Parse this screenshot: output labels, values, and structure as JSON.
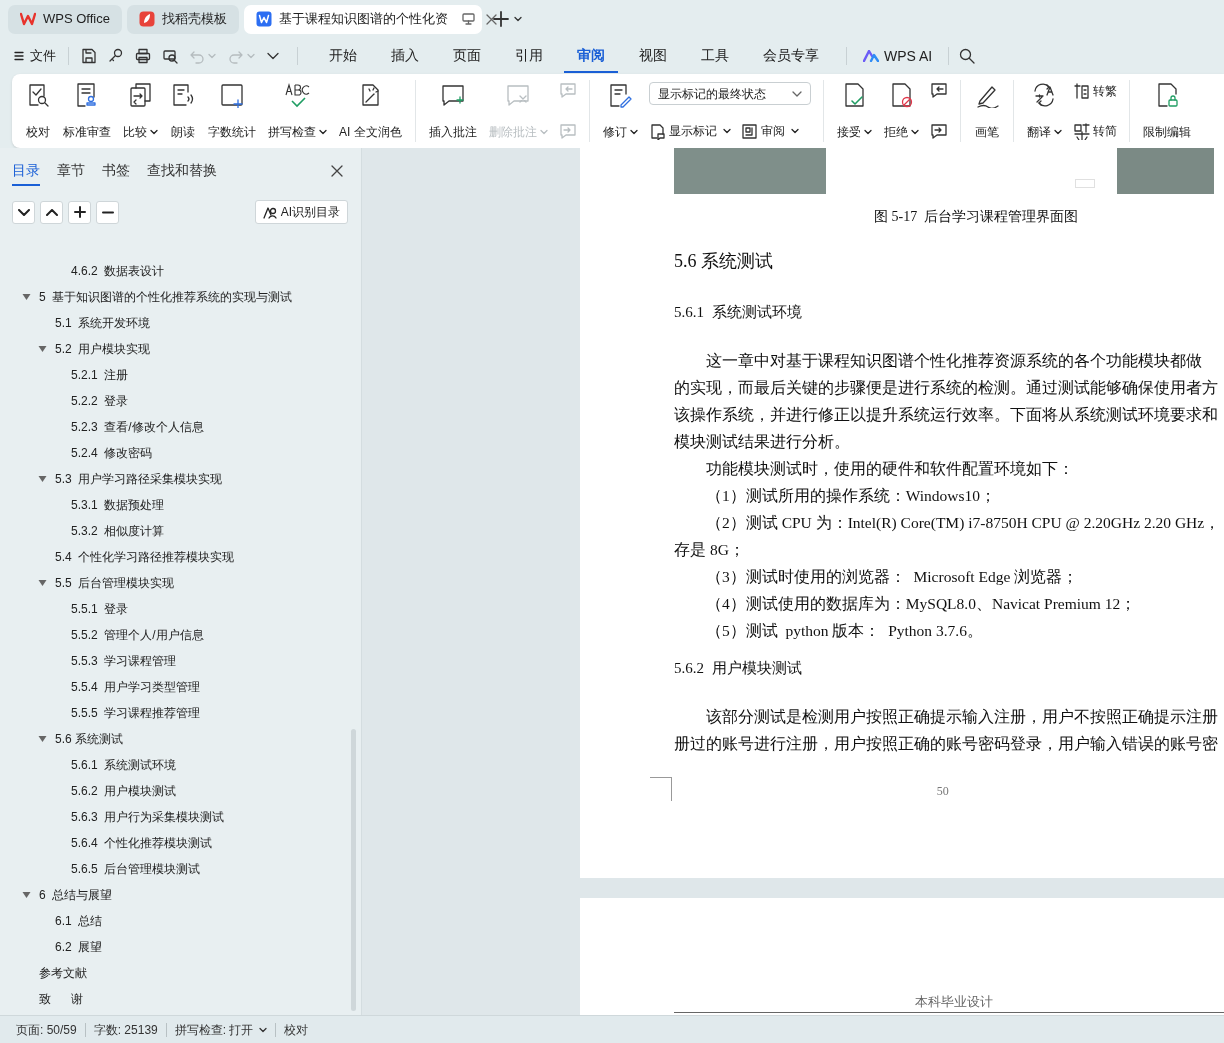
{
  "title_tabs": [
    {
      "label": "WPS Office",
      "selected": false,
      "kind": "home"
    },
    {
      "label": "找稻壳模板",
      "selected": false,
      "kind": "template"
    },
    {
      "label": "基于课程知识图谱的个性化资",
      "selected": true,
      "kind": "document"
    }
  ],
  "file_menu": "文件",
  "menu_tabs": [
    {
      "label": "开始",
      "selected": false
    },
    {
      "label": "插入",
      "selected": false
    },
    {
      "label": "页面",
      "selected": false
    },
    {
      "label": "引用",
      "selected": false
    },
    {
      "label": "审阅",
      "selected": true
    },
    {
      "label": "视图",
      "selected": false
    },
    {
      "label": "工具",
      "selected": false
    },
    {
      "label": "会员专享",
      "selected": false
    }
  ],
  "wps_ai": "WPS AI",
  "ribbon": {
    "groups": [
      {
        "columns": [
          {
            "kind": "large",
            "label": "校对",
            "dropdown": false,
            "disabled": false
          },
          {
            "kind": "large",
            "label": "标准审查",
            "dropdown": false,
            "disabled": false
          },
          {
            "kind": "large",
            "label": "比较",
            "dropdown": true,
            "disabled": false
          },
          {
            "kind": "large",
            "label": "朗读",
            "dropdown": false,
            "disabled": false
          },
          {
            "kind": "large",
            "label": "字数统计",
            "dropdown": false,
            "disabled": false
          },
          {
            "kind": "large",
            "label": "拼写检查",
            "dropdown": true,
            "disabled": false
          },
          {
            "kind": "large",
            "label": "AI 全文润色",
            "dropdown": false,
            "disabled": false
          }
        ]
      },
      {
        "columns": [
          {
            "kind": "large",
            "label": "插入批注",
            "dropdown": false,
            "disabled": false
          },
          {
            "kind": "large",
            "label": "删除批注",
            "dropdown": true,
            "disabled": true
          },
          {
            "kind": "stack",
            "rows": [
              [
                {
                  "kind": "icon",
                  "disabled": true
                }
              ],
              [
                {
                  "kind": "icon",
                  "disabled": true
                }
              ]
            ]
          }
        ]
      },
      {
        "columns": [
          {
            "kind": "large",
            "label": "修订",
            "dropdown": true,
            "disabled": false
          },
          {
            "kind": "stack",
            "rows": [
              [
                {
                  "kind": "select",
                  "value": "显示标记的最终状态"
                }
              ],
              [
                {
                  "kind": "small",
                  "label": "显示标记",
                  "dropdown": true,
                  "disabled": false
                },
                {
                  "kind": "small",
                  "label": "审阅",
                  "dropdown": true,
                  "disabled": false
                }
              ]
            ]
          }
        ]
      },
      {
        "columns": [
          {
            "kind": "large",
            "label": "接受",
            "dropdown": true,
            "disabled": false
          },
          {
            "kind": "large",
            "label": "拒绝",
            "dropdown": true,
            "disabled": false
          },
          {
            "kind": "stack",
            "rows": [
              [
                {
                  "kind": "icon",
                  "disabled": false
                }
              ],
              [
                {
                  "kind": "icon",
                  "disabled": false
                }
              ]
            ]
          }
        ]
      },
      {
        "columns": [
          {
            "kind": "large",
            "label": "画笔",
            "dropdown": false,
            "disabled": false
          }
        ]
      },
      {
        "columns": [
          {
            "kind": "large",
            "label": "翻译",
            "dropdown": true,
            "disabled": false
          },
          {
            "kind": "stack",
            "rows": [
              [
                {
                  "kind": "small",
                  "label": "转繁",
                  "dropdown": false,
                  "disabled": false
                }
              ],
              [
                {
                  "kind": "small",
                  "label": "转简",
                  "dropdown": false,
                  "disabled": false
                }
              ]
            ]
          }
        ]
      },
      {
        "columns": [
          {
            "kind": "large",
            "label": "限制编辑",
            "dropdown": false,
            "disabled": false
          }
        ]
      }
    ]
  },
  "sidebar": {
    "tabs": [
      {
        "label": "目录",
        "selected": true
      },
      {
        "label": "章节",
        "selected": false
      },
      {
        "label": "书签",
        "selected": false
      },
      {
        "label": "查找和替换",
        "selected": false
      }
    ],
    "ai_button": "AI识别目录",
    "toc": [
      {
        "children": [
          {
            "children": [
              {
                "label": "4.6.2  数据表设计"
              }
            ]
          }
        ]
      },
      {
        "label": "5  基于知识图谱的个性化推荐系统的实现与测试",
        "expanded": true,
        "children": [
          {
            "label": "5.1  系统开发环境"
          },
          {
            "label": "5.2  用户模块实现",
            "expanded": true,
            "children": [
              {
                "label": "5.2.1  注册"
              },
              {
                "label": "5.2.2  登录"
              },
              {
                "label": "5.2.3  查看/修改个人信息"
              },
              {
                "label": "5.2.4  修改密码"
              }
            ]
          },
          {
            "label": "5.3  用户学习路径采集模块实现",
            "expanded": true,
            "children": [
              {
                "label": "5.3.1  数据预处理"
              },
              {
                "label": "5.3.2  相似度计算"
              }
            ]
          },
          {
            "label": "5.4  个性化学习路径推荐模块实现"
          },
          {
            "label": "5.5  后台管理模块实现",
            "expanded": true,
            "children": [
              {
                "label": "5.5.1  登录"
              },
              {
                "label": "5.5.2  管理个人/用户信息"
              },
              {
                "label": "5.5.3  学习课程管理"
              },
              {
                "label": "5.5.4  用户学习类型管理"
              },
              {
                "label": "5.5.5  学习课程推荐管理"
              }
            ]
          },
          {
            "label": "5.6 系统测试",
            "expanded": true,
            "children": [
              {
                "label": "5.6.1  系统测试环境"
              },
              {
                "label": "5.6.2  用户模块测试"
              },
              {
                "label": "5.6.3  用户行为采集模块测试"
              },
              {
                "label": "5.6.4  个性化推荐模块测试"
              },
              {
                "label": "5.6.5  后台管理模块测试"
              }
            ]
          }
        ]
      },
      {
        "label": "6  总结与展望",
        "expanded": true,
        "children": [
          {
            "label": "6.1  总结"
          },
          {
            "label": "6.2  展望"
          }
        ]
      },
      {
        "label": "参考文献"
      },
      {
        "label": "致      谢"
      }
    ]
  },
  "document": {
    "blocks": [
      {
        "kind": "figure"
      },
      {
        "kind": "caption",
        "text": "图 5-17  后台学习课程管理界面图"
      },
      {
        "kind": "heading",
        "text": "5.6 系统测试"
      },
      {
        "kind": "subheading",
        "text": "5.6.1  系统测试环境"
      },
      {
        "kind": "paragraph",
        "lines": [
          "这一章中对基于课程知识图谱个性化推荐资源系统的各个功能模块都做",
          "的实现，而最后关键的步骤便是进行系统的检测。通过测试能够确保使用者方",
          "该操作系统，并进行修正以提升系统运行效率。下面将从系统测试环境要求和",
          "模块测试结果进行分析。"
        ]
      },
      {
        "kind": "paragraph",
        "lines": [
          "功能模块测试时，使用的硬件和软件配置环境如下："
        ]
      },
      {
        "kind": "paragraph",
        "lines": [
          "（1）测试所用的操作系统：Windows10；"
        ]
      },
      {
        "kind": "paragraph",
        "lines": [
          "（2）测试 CPU 为：Intel(R) Core(TM) i7-8750H CPU @ 2.20GHz 2.20 GHz，",
          "存是 8G；"
        ]
      },
      {
        "kind": "paragraph",
        "lines": [
          "（3）测试时使用的浏览器：  Microsoft Edge 浏览器；"
        ]
      },
      {
        "kind": "paragraph",
        "lines": [
          "（4）测试使用的数据库为：MySQL8.0、Navicat Premium 12；"
        ]
      },
      {
        "kind": "paragraph",
        "lines": [
          "（5）测试  python 版本：  Python 3.7.6。"
        ]
      },
      {
        "kind": "subheading",
        "text": "5.6.2  用户模块测试"
      },
      {
        "kind": "paragraph",
        "lines": [
          "该部分测试是检测用户按照正确提示输入注册，用户不按照正确提示注册",
          "册过的账号进行注册，用户按照正确的账号密码登录，用户输入错误的账号密"
        ]
      }
    ],
    "page_number": "50",
    "next_page_header": "本科毕业设计"
  },
  "status_bar": [
    {
      "label": "页面: 50/59",
      "dropdown": false
    },
    {
      "label": "字数: 25139",
      "dropdown": false
    },
    {
      "label": "拼写检查: 打开",
      "dropdown": true
    },
    {
      "label": "校对",
      "dropdown": false
    }
  ]
}
